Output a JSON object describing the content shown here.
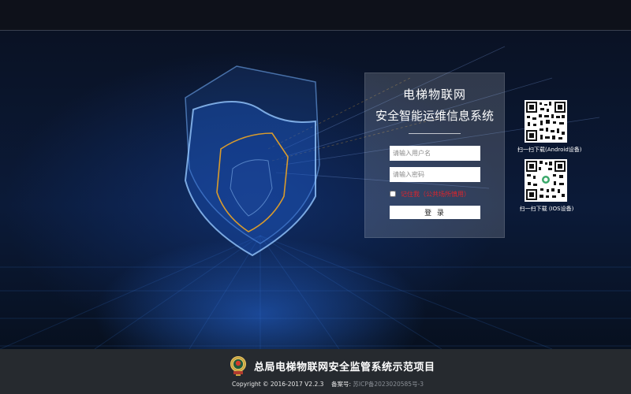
{
  "login": {
    "title": "电梯物联网",
    "subtitle": "安全智能运维信息系统",
    "username_placeholder": "请输入用户名",
    "password_placeholder": "请输入密码",
    "remember_label": "记住我（公共场所慎用）",
    "submit_label": "登 录"
  },
  "downloads": {
    "android_caption": "扫一扫下载(Android设备)",
    "ios_caption": "扫一扫下载 (IOS设备)"
  },
  "footer": {
    "title": "总局电梯物联网安全监管系统示范项目",
    "copyright": "Copyright © 2016-2017 V2.2.3",
    "icp_label": "备案号:",
    "icp_value": "苏ICP备2023020585号-3"
  },
  "colors": {
    "accent_red": "#e0242b",
    "footer_bg": "#262a2f",
    "top_bar_bg": "#0e111a"
  },
  "icons": [
    "shield-illustration",
    "emblem-icon",
    "qr-code-android",
    "qr-code-ios"
  ]
}
